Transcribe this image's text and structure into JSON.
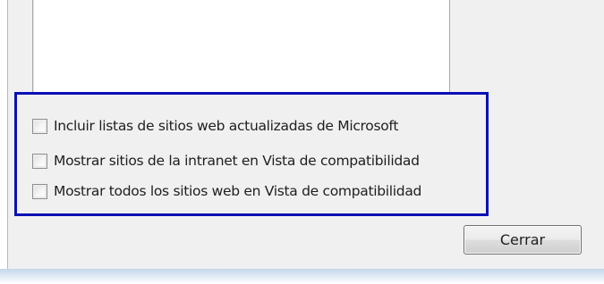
{
  "options": [
    {
      "label": "Incluir listas de sitios web actualizadas de Microsoft",
      "checked": false
    },
    {
      "label": "Mostrar sitios de la intranet en Vista de compatibilidad",
      "checked": false
    },
    {
      "label": "Mostrar todos los sitios web en Vista de compatibilidad",
      "checked": false
    }
  ],
  "close_button": {
    "label": "Cerrar"
  },
  "colors": {
    "highlight_border": "#0a10b4",
    "dialog_background": "#f0f0f0"
  }
}
